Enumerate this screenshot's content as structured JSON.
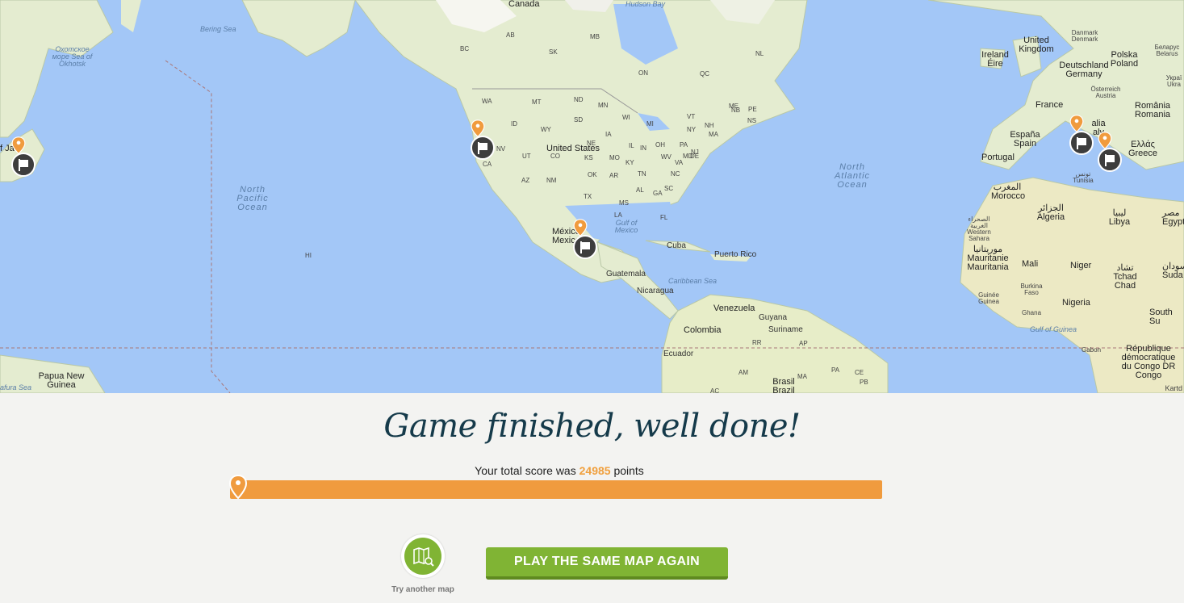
{
  "map": {
    "labels": {
      "canada": "Canada",
      "hudson_bay": "Hudson Bay",
      "bering_sea": "Bering Sea",
      "okhotsk": "Охотское море Sea of Okhotsk",
      "united_states": "United States",
      "north_pacific": "North Pacific Ocean",
      "north_atlantic": "North Atlantic Ocean",
      "gulf_of_mexico": "Gulf of Mexico",
      "caribbean": "Caribbean Sea",
      "mexico": "México Mexico",
      "cuba": "Cuba",
      "puerto_rico": "Puerto Rico",
      "guatemala": "Guatemala",
      "nicaragua": "Nicaragua",
      "venezuela": "Venezuela",
      "colombia": "Colombia",
      "guyana": "Guyana",
      "suriname": "Suriname",
      "ecuador": "Ecuador",
      "brasil": "Brasil Brazil",
      "papua": "Papua New Guinea",
      "arafura": "afura Sea",
      "hi": "HI",
      "united_kingdom": "United Kingdom",
      "ireland": "Ireland Éire",
      "denmark": "Danmark Denmark",
      "deutschland": "Deutschland Germany",
      "polska": "Polska Poland",
      "belarus": "Беларус Belarus",
      "ukraine": "Украї Ukra",
      "france": "France",
      "espana": "España Spain",
      "portugal": "Portugal",
      "italia": "alia aly",
      "osterreich": "Österreich Austria",
      "romania": "România Romania",
      "greece": "Ελλάς Greece",
      "morocco": "المغرب Morocco",
      "algeria": "الجزائر Algeria",
      "tunisia": "تونس Tunisia",
      "libya": "ليبيا Libya",
      "egypt": "مصر Egypt",
      "western_sahara": "الصحراء الغربية Western Sahara",
      "mauritania": "موريتانيا Mauritanie Mauritania",
      "mali": "Mali",
      "niger": "Niger",
      "chad": "تشاد Tchad Chad",
      "sudan": "السودان Suda",
      "burkina": "Burkina Faso",
      "guinee": "Guinée Guinea",
      "ghana": "Ghana",
      "nigeria": "Nigeria",
      "gulf_guinea": "Gulf of Guinea",
      "gabon": "Gabon",
      "drc": "République démocratique du Congo DR Congo",
      "south_sudan": "South Su",
      "japan": "f Ja n",
      "kartdata": "Kartd"
    },
    "states": [
      "WA",
      "MT",
      "ND",
      "MN",
      "WI",
      "MI",
      "ID",
      "WY",
      "SD",
      "IA",
      "NE",
      "NV",
      "UT",
      "CO",
      "KS",
      "MO",
      "IL",
      "IN",
      "OH",
      "PA",
      "NY",
      "CA",
      "AZ",
      "NM",
      "OK",
      "AR",
      "TN",
      "KY",
      "WV",
      "VA",
      "NC",
      "SC",
      "GA",
      "AL",
      "MS",
      "LA",
      "TX",
      "FL",
      "ME",
      "NH",
      "VT",
      "MA",
      "NJ",
      "MD",
      "DE",
      "NB",
      "PE",
      "NS",
      "QC",
      "ON",
      "NL",
      "AB",
      "BC",
      "SK",
      "MB",
      "AC",
      "AM",
      "RR",
      "AP",
      "PA",
      "MA",
      "CE",
      "PB"
    ],
    "colors": {
      "water": "#a3c7f7",
      "land": "#e4ecd0",
      "marker": "#f09b3e",
      "flag": "#3d3d3d"
    }
  },
  "result": {
    "title": "Game finished, well done!",
    "score_prefix": "Your total score was",
    "score_value": "24985",
    "score_suffix": "points",
    "progress_fraction": 1.0
  },
  "actions": {
    "try_another_label": "Try another map",
    "play_again_label": "PLAY THE SAME MAP AGAIN",
    "try_another_icon": "map-search-icon"
  },
  "colors": {
    "accent": "#f09b3e",
    "button": "#80b434",
    "title": "#153a4a"
  }
}
